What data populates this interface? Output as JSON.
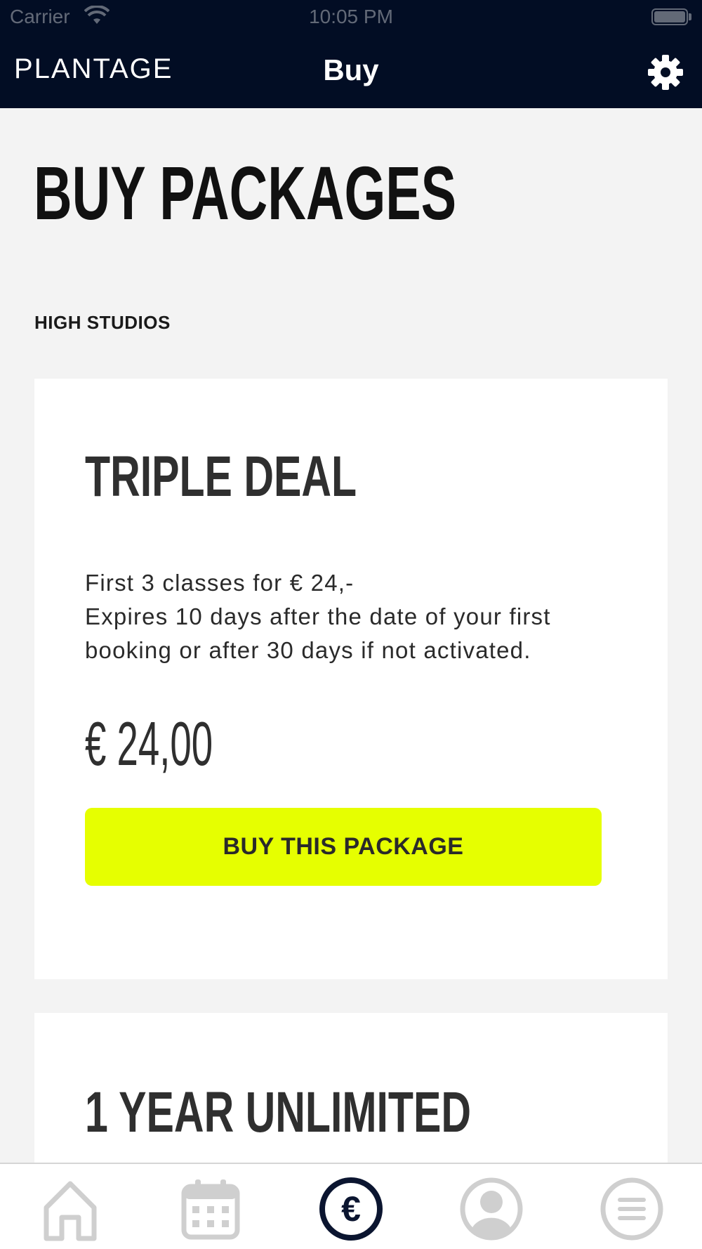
{
  "status_bar": {
    "carrier": "Carrier",
    "time": "10:05 PM"
  },
  "header": {
    "brand": "PLANTAGE",
    "title": "Buy",
    "settings_icon": "gear-icon"
  },
  "page": {
    "title": "BUY PACKAGES",
    "section": "HIGH STUDIOS"
  },
  "packages": [
    {
      "name": "TRIPLE DEAL",
      "description_lines": [
        "First 3 classes for € 24,-",
        "Expires 10 days after the date of your first",
        "booking or after 30 days if not activated."
      ],
      "price": "€ 24,00",
      "button_label": "BUY THIS PACKAGE"
    },
    {
      "name": "1 YEAR UNLIMITED"
    }
  ],
  "tabbar": {
    "items": [
      {
        "icon": "home-icon",
        "active": false
      },
      {
        "icon": "calendar-icon",
        "active": false
      },
      {
        "icon": "euro-icon",
        "active": true
      },
      {
        "icon": "profile-icon",
        "active": false
      },
      {
        "icon": "menu-icon",
        "active": false
      }
    ]
  },
  "colors": {
    "header_bg": "#020d24",
    "accent": "#e6ff00",
    "page_bg": "#f3f3f3",
    "tab_active": "#0b1530",
    "tab_inactive": "#cfcfcf"
  }
}
